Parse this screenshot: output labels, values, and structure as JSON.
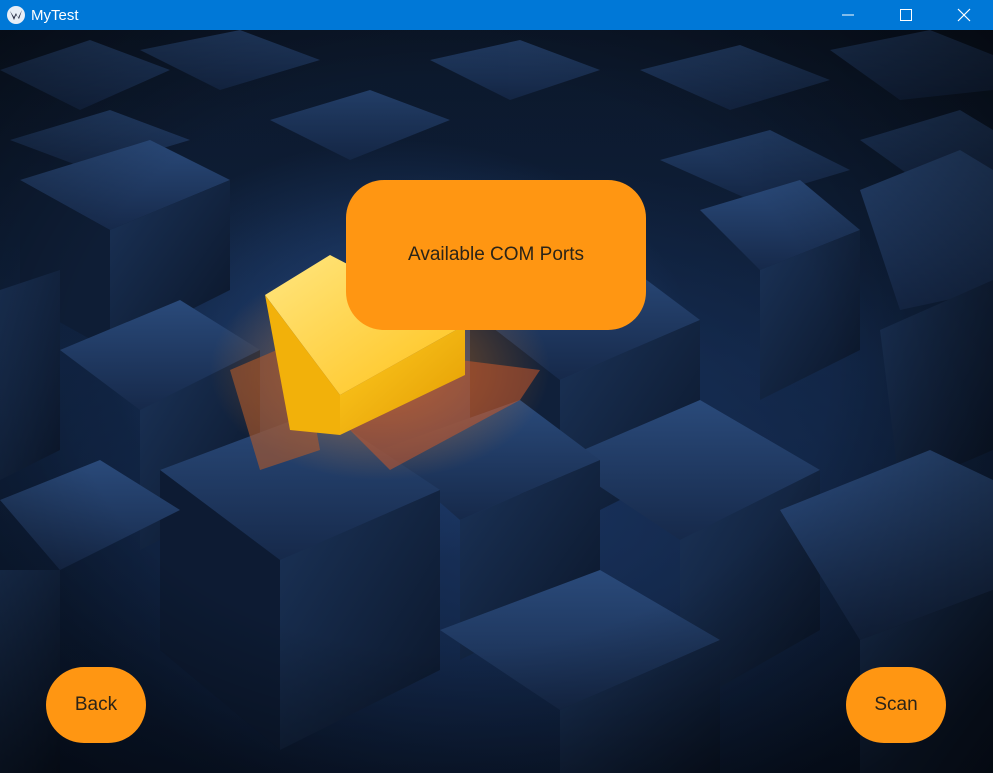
{
  "window": {
    "title": "MyTest",
    "app_icon": "kivy-logo-icon",
    "controls": [
      "minimize-icon",
      "maximize-icon",
      "close-icon"
    ]
  },
  "main": {
    "label": "Available COM Ports",
    "back_label": "Back",
    "scan_label": "Scan"
  },
  "colors": {
    "titlebar": "#0078d7",
    "accent": "#ff9612",
    "text_dark": "#2b2418"
  }
}
